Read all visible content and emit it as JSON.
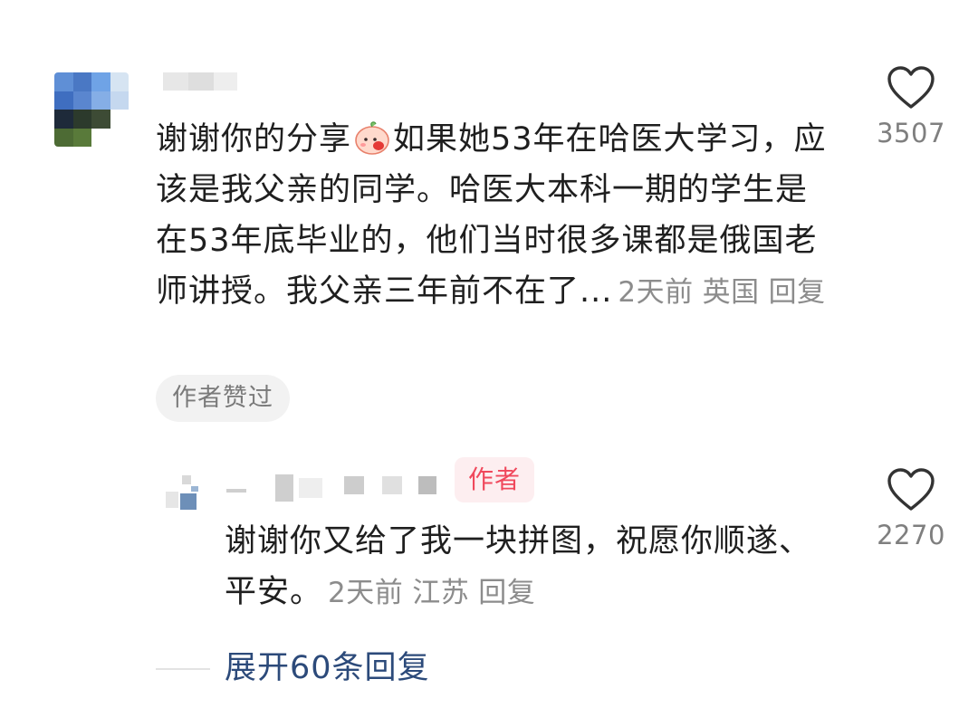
{
  "main_comment": {
    "text_part1": "谢谢你的分享",
    "emoji_icon": "blushing-peach-emoji",
    "text_part2": "如果她53年在哈医大学习，应该是我父亲的同学。哈医大本科一期的学生是在53年底毕业的，他们当时很多课都是俄国老师讲授。我父亲三年前不在了...",
    "time": "2天前",
    "location": "英国",
    "reply_label": "回复",
    "author_liked_tag": "作者赞过",
    "like_count": "3507",
    "like_icon": "heart-outline-icon"
  },
  "reply_comment": {
    "author_badge": "作者",
    "text": "谢谢你又给了我一块拼图，祝愿你顺遂、平安。",
    "time": "2天前",
    "location": "江苏",
    "reply_label": "回复",
    "like_count": "2270",
    "like_icon": "heart-outline-icon"
  },
  "expand_replies_label": "展开60条回复",
  "colors": {
    "text_primary": "#1f1f1f",
    "text_secondary": "#8c8c8c",
    "author_badge_text": "#f0485c",
    "author_badge_bg": "#fdeef0",
    "expand_link": "#2c4a7a"
  }
}
